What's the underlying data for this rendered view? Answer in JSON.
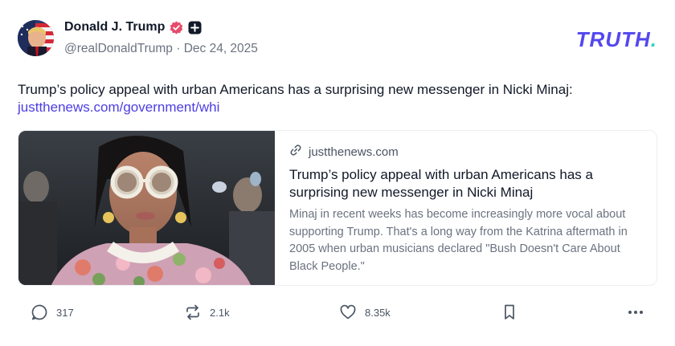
{
  "author": {
    "display_name": "Donald J. Trump",
    "handle": "@realDonaldTrump",
    "separator": "·",
    "date": "Dec 24, 2025",
    "verified_icon": "verified-badge-icon",
    "plus_icon": "plus-badge-icon"
  },
  "brand": {
    "logo_text": "TRUTH",
    "logo_dot": ".",
    "logo_color": "#5448ee",
    "dot_color": "#34d1c4"
  },
  "post": {
    "text": "Trump’s policy appeal with urban Americans has a surprising new messenger in Nicki Minaj:",
    "link_text": "justthenews.com/government/whi",
    "link_color": "#4b3ee3"
  },
  "link_card": {
    "domain": "justthenews.com",
    "title": "Trump’s policy appeal with urban Americans has a surprising new messenger in Nicki Minaj",
    "description": "Minaj in recent weeks has become increasingly more vocal about supporting Trump. That's a long way from the Katrina aftermath in 2005 when urban musicians declared \"Bush Doesn't Care About Black People.\"",
    "image_icon": "article-photo"
  },
  "actions": {
    "replies": "317",
    "retruths": "2.1k",
    "likes": "8.35k"
  }
}
